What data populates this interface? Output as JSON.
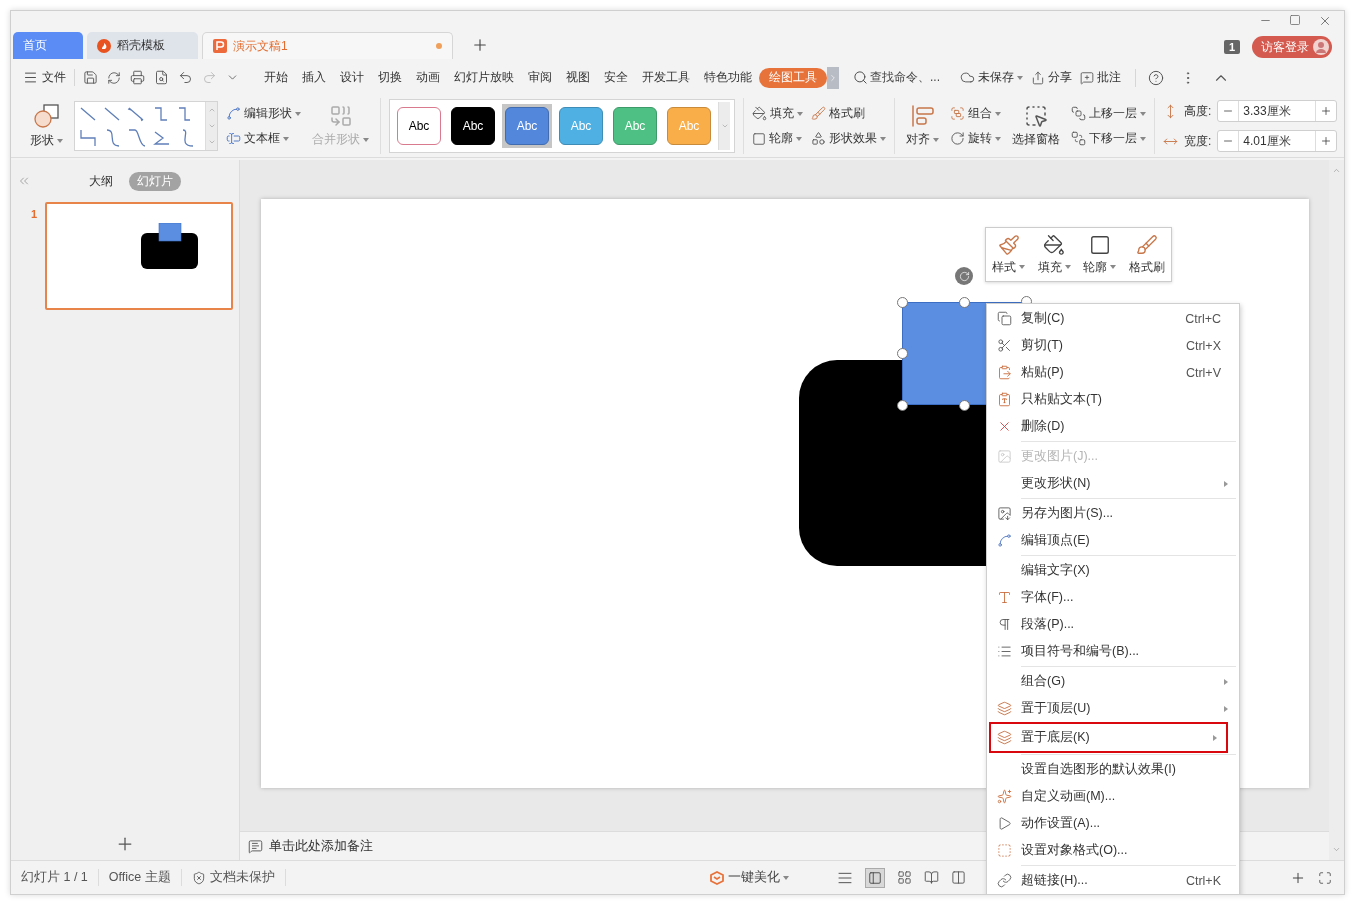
{
  "tabs": [
    {
      "kind": "home",
      "label": "首页",
      "selected": false,
      "modified": false
    },
    {
      "kind": "template",
      "label": "稻壳模板",
      "selected": false,
      "modified": false
    },
    {
      "kind": "document",
      "label": "演示文稿1",
      "selected": true,
      "modified": true
    }
  ],
  "account": {
    "window_count": "1",
    "login": "访客登录"
  },
  "menu_bar": {
    "file": "文件",
    "tabs": [
      {
        "label": "开始",
        "selected": false
      },
      {
        "label": "插入",
        "selected": false
      },
      {
        "label": "设计",
        "selected": false
      },
      {
        "label": "切换",
        "selected": false
      },
      {
        "label": "动画",
        "selected": false
      },
      {
        "label": "幻灯片放映",
        "selected": false
      },
      {
        "label": "审阅",
        "selected": false
      },
      {
        "label": "视图",
        "selected": false
      },
      {
        "label": "安全",
        "selected": false
      },
      {
        "label": "开发工具",
        "selected": false
      },
      {
        "label": "特色功能",
        "selected": false
      },
      {
        "label": "绘图工具",
        "selected": true
      }
    ],
    "search_placeholder": "查找命令、...",
    "actions": [
      "未保存",
      "分享",
      "批注"
    ]
  },
  "ribbon": {
    "shape": {
      "label": "形状",
      "dropdown": true
    },
    "edit_shape": {
      "label": "编辑形状",
      "dropdown": true
    },
    "text_box": {
      "label": "文本框",
      "dropdown": true
    },
    "merge_shape": {
      "label": "合并形状",
      "dropdown": true,
      "disabled": true
    },
    "styles": [
      {
        "label": "Abc",
        "color": "#ffffff",
        "selected": false
      },
      {
        "label": "Abc",
        "color": "#000000",
        "selected": false
      },
      {
        "label": "Abc",
        "color": "#5287dc",
        "selected": true
      },
      {
        "label": "Abc",
        "color": "#4fb0e3",
        "selected": false
      },
      {
        "label": "Abc",
        "color": "#4fc083",
        "selected": false
      },
      {
        "label": "Abc",
        "color": "#f9ae4a",
        "selected": false
      }
    ],
    "fill": {
      "label": "填充",
      "dropdown": true
    },
    "format_painter": {
      "label": "格式刷",
      "dropdown": false
    },
    "outline": {
      "label": "轮廓",
      "dropdown": true
    },
    "shape_effects": {
      "label": "形状效果",
      "dropdown": true
    },
    "align": {
      "label": "对齐",
      "dropdown": true
    },
    "group": {
      "label": "组合",
      "dropdown": true
    },
    "rotate": {
      "label": "旋转",
      "dropdown": true
    },
    "selection_pane": {
      "label": "选择窗格",
      "dropdown": false
    },
    "bring_forward": {
      "label": "上移一层",
      "dropdown": true
    },
    "send_backward": {
      "label": "下移一层",
      "dropdown": true
    },
    "height": {
      "label": "高度:",
      "value": "3.33厘米"
    },
    "width": {
      "label": "宽度:",
      "value": "4.01厘米"
    }
  },
  "side_panel": {
    "tabs": [
      {
        "label": "大纲",
        "selected": false
      },
      {
        "label": "幻灯片",
        "selected": true
      }
    ],
    "thumbnails": [
      {
        "number": "1",
        "selected": true
      }
    ]
  },
  "mini_toolbar": [
    {
      "label": "样式",
      "dropdown": true
    },
    {
      "label": "填充",
      "dropdown": true
    },
    {
      "label": "轮廓",
      "dropdown": true
    },
    {
      "label": "格式刷",
      "dropdown": false
    }
  ],
  "context_menu": {
    "sections": [
      [
        {
          "label": "复制(C)",
          "shortcut": "Ctrl+C",
          "disabled": false,
          "submenu": false,
          "highlighted": false
        },
        {
          "label": "剪切(T)",
          "shortcut": "Ctrl+X",
          "disabled": false,
          "submenu": false,
          "highlighted": false
        },
        {
          "label": "粘贴(P)",
          "shortcut": "Ctrl+V",
          "disabled": false,
          "submenu": false,
          "highlighted": false
        },
        {
          "label": "只粘贴文本(T)",
          "disabled": false,
          "submenu": false,
          "highlighted": false
        },
        {
          "label": "删除(D)",
          "disabled": false,
          "submenu": false,
          "highlighted": false
        }
      ],
      [
        {
          "label": "更改图片(J)...",
          "disabled": true,
          "submenu": false,
          "highlighted": false
        },
        {
          "label": "更改形状(N)",
          "disabled": false,
          "submenu": true,
          "highlighted": false
        }
      ],
      [
        {
          "label": "另存为图片(S)...",
          "disabled": false,
          "submenu": false,
          "highlighted": false
        },
        {
          "label": "编辑顶点(E)",
          "disabled": false,
          "submenu": false,
          "highlighted": false
        }
      ],
      [
        {
          "label": "编辑文字(X)",
          "disabled": false,
          "submenu": false,
          "highlighted": false
        },
        {
          "label": "字体(F)...",
          "disabled": false,
          "submenu": false,
          "highlighted": false
        },
        {
          "label": "段落(P)...",
          "disabled": false,
          "submenu": false,
          "highlighted": false
        },
        {
          "label": "项目符号和编号(B)...",
          "disabled": false,
          "submenu": false,
          "highlighted": false
        }
      ],
      [
        {
          "label": "组合(G)",
          "disabled": false,
          "submenu": true,
          "highlighted": false
        },
        {
          "label": "置于顶层(U)",
          "disabled": false,
          "submenu": true,
          "highlighted": false
        },
        {
          "label": "置于底层(K)",
          "disabled": false,
          "submenu": true,
          "highlighted": true
        }
      ],
      [
        {
          "label": "设置自选图形的默认效果(I)",
          "disabled": false,
          "submenu": false,
          "highlighted": false
        },
        {
          "label": "自定义动画(M)...",
          "disabled": false,
          "submenu": false,
          "highlighted": false
        },
        {
          "label": "动作设置(A)...",
          "disabled": false,
          "submenu": false,
          "highlighted": false
        },
        {
          "label": "设置对象格式(O)...",
          "disabled": false,
          "submenu": false,
          "highlighted": false
        }
      ],
      [
        {
          "label": "超链接(H)...",
          "shortcut": "Ctrl+K",
          "disabled": false,
          "submenu": false,
          "highlighted": false
        }
      ]
    ]
  },
  "notes_placeholder": "单击此处添加备注",
  "status_bar": {
    "slide": "幻灯片 1 / 1",
    "theme": "Office 主题",
    "protection": "文档未保护",
    "beautify": "一键美化"
  }
}
